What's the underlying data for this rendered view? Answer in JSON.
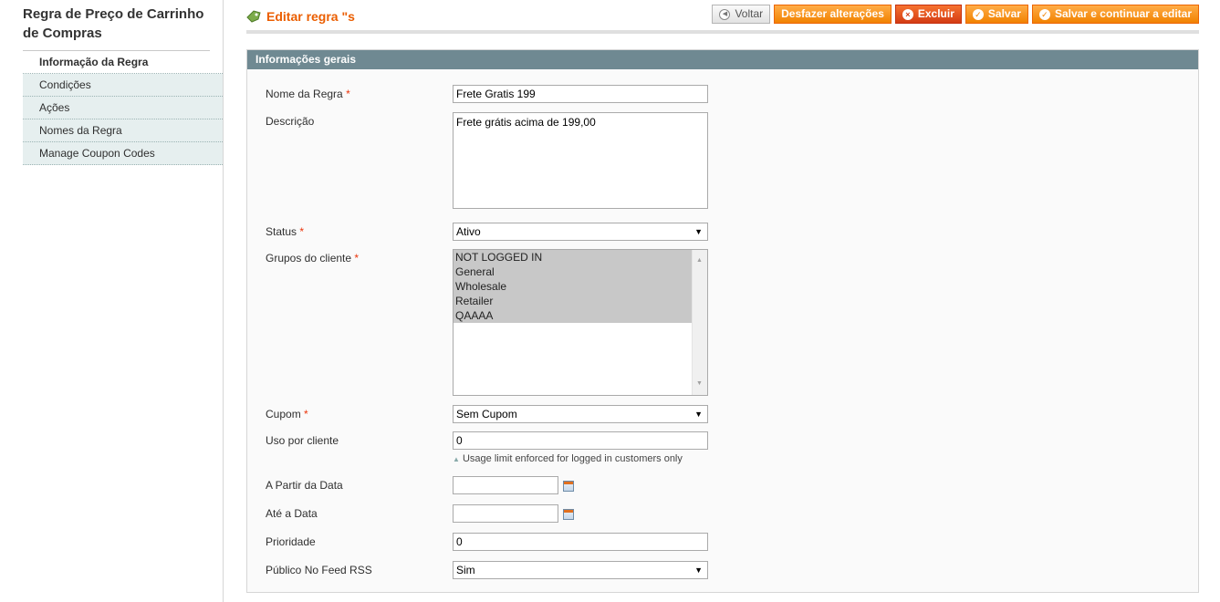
{
  "sidebar": {
    "title": "Regra de Preço de Carrinho de Compras",
    "tabs": [
      {
        "label": "Informação da Regra"
      },
      {
        "label": "Condições"
      },
      {
        "label": "Ações"
      },
      {
        "label": "Nomes da Regra"
      },
      {
        "label": "Manage Coupon Codes"
      }
    ]
  },
  "header": {
    "title": "Editar regra \"s",
    "buttons": {
      "back": "Voltar",
      "reset": "Desfazer alterações",
      "delete": "Excluir",
      "save": "Salvar",
      "save_continue": "Salvar e continuar a editar"
    }
  },
  "form": {
    "legend": "Informações gerais",
    "required_mark": "*",
    "name": {
      "label": "Nome da Regra",
      "value": "Frete Gratis 199"
    },
    "description": {
      "label": "Descrição",
      "value": "Frete grátis acima de 199,00"
    },
    "status": {
      "label": "Status",
      "value": "Ativo"
    },
    "customer_groups": {
      "label": "Grupos do cliente",
      "options": [
        "NOT LOGGED IN",
        "General",
        "Wholesale",
        "Retailer",
        "QAAAA"
      ]
    },
    "coupon": {
      "label": "Cupom",
      "value": "Sem Cupom"
    },
    "uses_per_customer": {
      "label": "Uso por cliente",
      "value": "0",
      "note": "Usage limit enforced for logged in customers only"
    },
    "from_date": {
      "label": "A Partir da Data",
      "value": ""
    },
    "to_date": {
      "label": "Até a Data",
      "value": ""
    },
    "priority": {
      "label": "Prioridade",
      "value": "0"
    },
    "rss": {
      "label": "Público No Feed RSS",
      "value": "Sim"
    }
  },
  "colors": {
    "accent": "#eb5e00",
    "button": "#f18200",
    "section_header": "#6f8992"
  }
}
